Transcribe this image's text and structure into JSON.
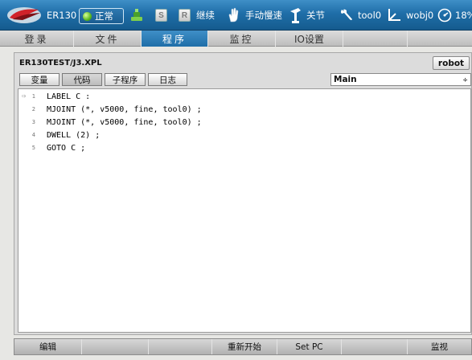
{
  "status_bar": {
    "model": "ER130",
    "state": "正常",
    "continue_label": "继续",
    "speed_mode": "手动慢速",
    "joint_label": "关节",
    "tool": "tool0",
    "wobj": "wobj0",
    "speed_percent": "18%",
    "s_button": "S",
    "r_button": "R",
    "icons": [
      "er-logo",
      "green-status-dot",
      "robot-icon",
      "hand-icon",
      "joint-icon",
      "wrench-icon",
      "coordinate-icon",
      "speed-dial-icon"
    ]
  },
  "main_menu": {
    "items": [
      "登录",
      "文件",
      "程序",
      "监控",
      "IO设置"
    ],
    "active": "程序"
  },
  "program": {
    "path": "ER130TEST/J3.XPL",
    "robot_button": "robot",
    "tabs": [
      "变量",
      "代码",
      "子程序",
      "日志"
    ],
    "selected_tab": "代码",
    "routine": "Main",
    "routine_arrow": "÷",
    "line_marker": "⇨",
    "lines": [
      {
        "num": "1",
        "code": "LABEL C :"
      },
      {
        "num": "2",
        "code": "MJOINT (*, v5000, fine, tool0) ;"
      },
      {
        "num": "3",
        "code": "MJOINT (*, v5000, fine, tool0) ;"
      },
      {
        "num": "4",
        "code": "DWELL (2) ;"
      },
      {
        "num": "5",
        "code": "GOTO C ;"
      }
    ]
  },
  "bottom_bar": {
    "edit": "编辑",
    "restart": "重新开始",
    "set_pc": "Set PC",
    "monitor": "监视"
  },
  "colors": {
    "accent": "#1f6ea8",
    "status_green": "#5bb81e"
  }
}
